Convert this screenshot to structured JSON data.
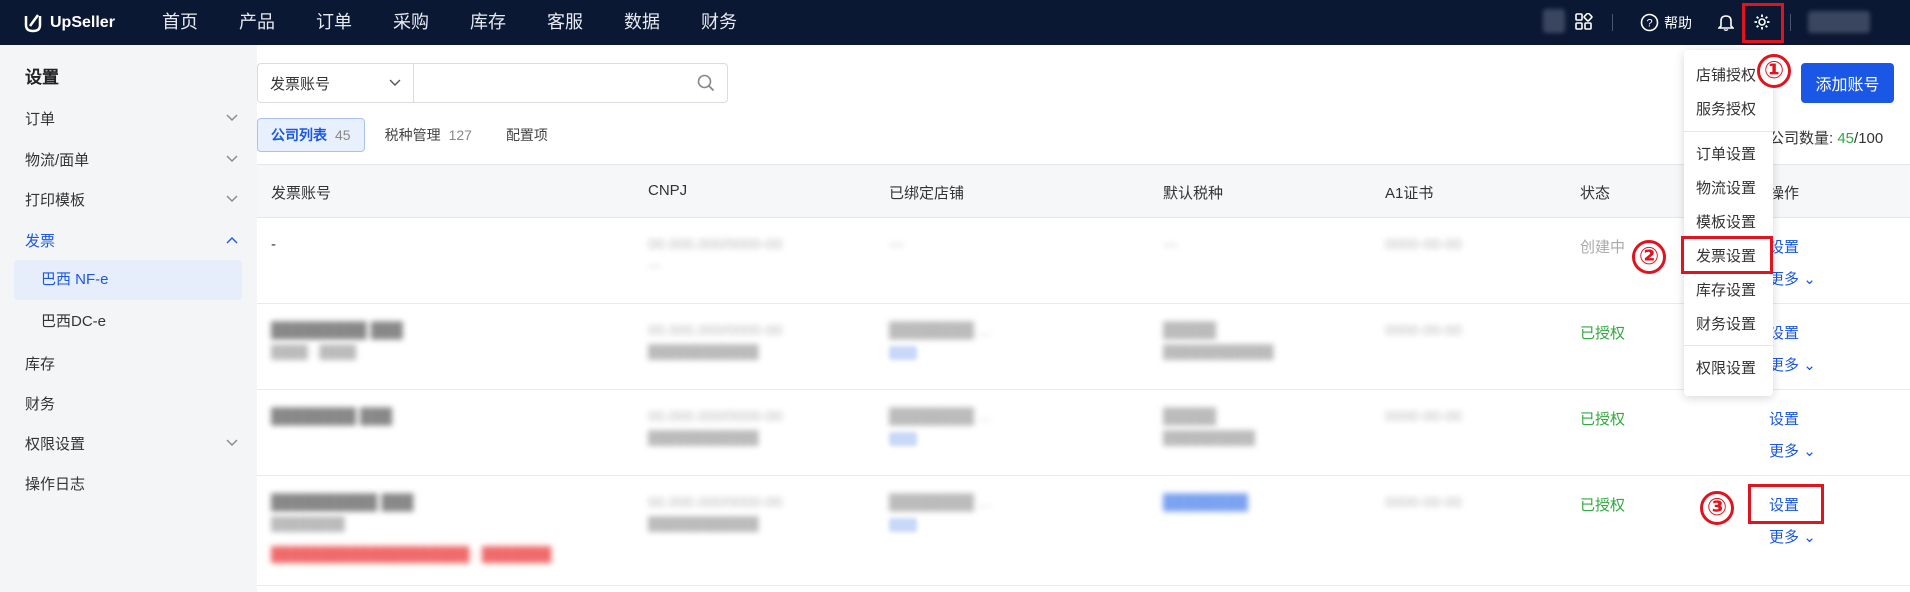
{
  "brand": {
    "name": "UpSeller"
  },
  "nav": [
    "首页",
    "产品",
    "订单",
    "采购",
    "库存",
    "客服",
    "数据",
    "财务"
  ],
  "header": {
    "help_label": "帮助"
  },
  "sidebar": {
    "title": "设置",
    "items": [
      {
        "label": "订单"
      },
      {
        "label": "物流/面单"
      },
      {
        "label": "打印模板"
      },
      {
        "label": "发票"
      },
      {
        "label": "库存"
      },
      {
        "label": "财务"
      },
      {
        "label": "权限设置"
      },
      {
        "label": "操作日志"
      }
    ],
    "sub_items": [
      {
        "label": "巴西 NF-e"
      },
      {
        "label": "巴西DC-e"
      }
    ]
  },
  "filter": {
    "select_value": "发票账号",
    "search_placeholder": ""
  },
  "tabs": [
    {
      "label": "公司列表",
      "count": "45"
    },
    {
      "label": "税种管理",
      "count": "127"
    },
    {
      "label": "配置项",
      "count": ""
    }
  ],
  "actions": {
    "add_label": "添加账号"
  },
  "summary": {
    "label": "公司数量:",
    "current": "45",
    "sep": "/",
    "max": "100"
  },
  "table": {
    "headers": [
      "发票账号",
      "CNPJ",
      "已绑定店铺",
      "默认税种",
      "A1证书",
      "状态",
      "操作"
    ],
    "rows": [
      {
        "account": "-",
        "status": "创建中",
        "action": "设置",
        "more": "更多"
      },
      {
        "account": "",
        "status": "已授权",
        "action": "设置",
        "more": "更多"
      },
      {
        "account": "",
        "status": "已授权",
        "action": "设置",
        "more": "更多"
      },
      {
        "account": "",
        "status": "已授权",
        "action": "设置",
        "more": "更多"
      }
    ]
  },
  "settings_menu": {
    "items": [
      "店铺授权",
      "服务授权",
      "订单设置",
      "物流设置",
      "模板设置",
      "发票设置",
      "库存设置",
      "财务设置",
      "权限设置"
    ]
  },
  "annotations": {
    "step1": "①",
    "step2": "②",
    "step3": "③"
  },
  "colors": {
    "topbar": "#0b1833",
    "accent": "#1a57e6",
    "success": "#2faa3e",
    "annotation": "#e0141e"
  }
}
